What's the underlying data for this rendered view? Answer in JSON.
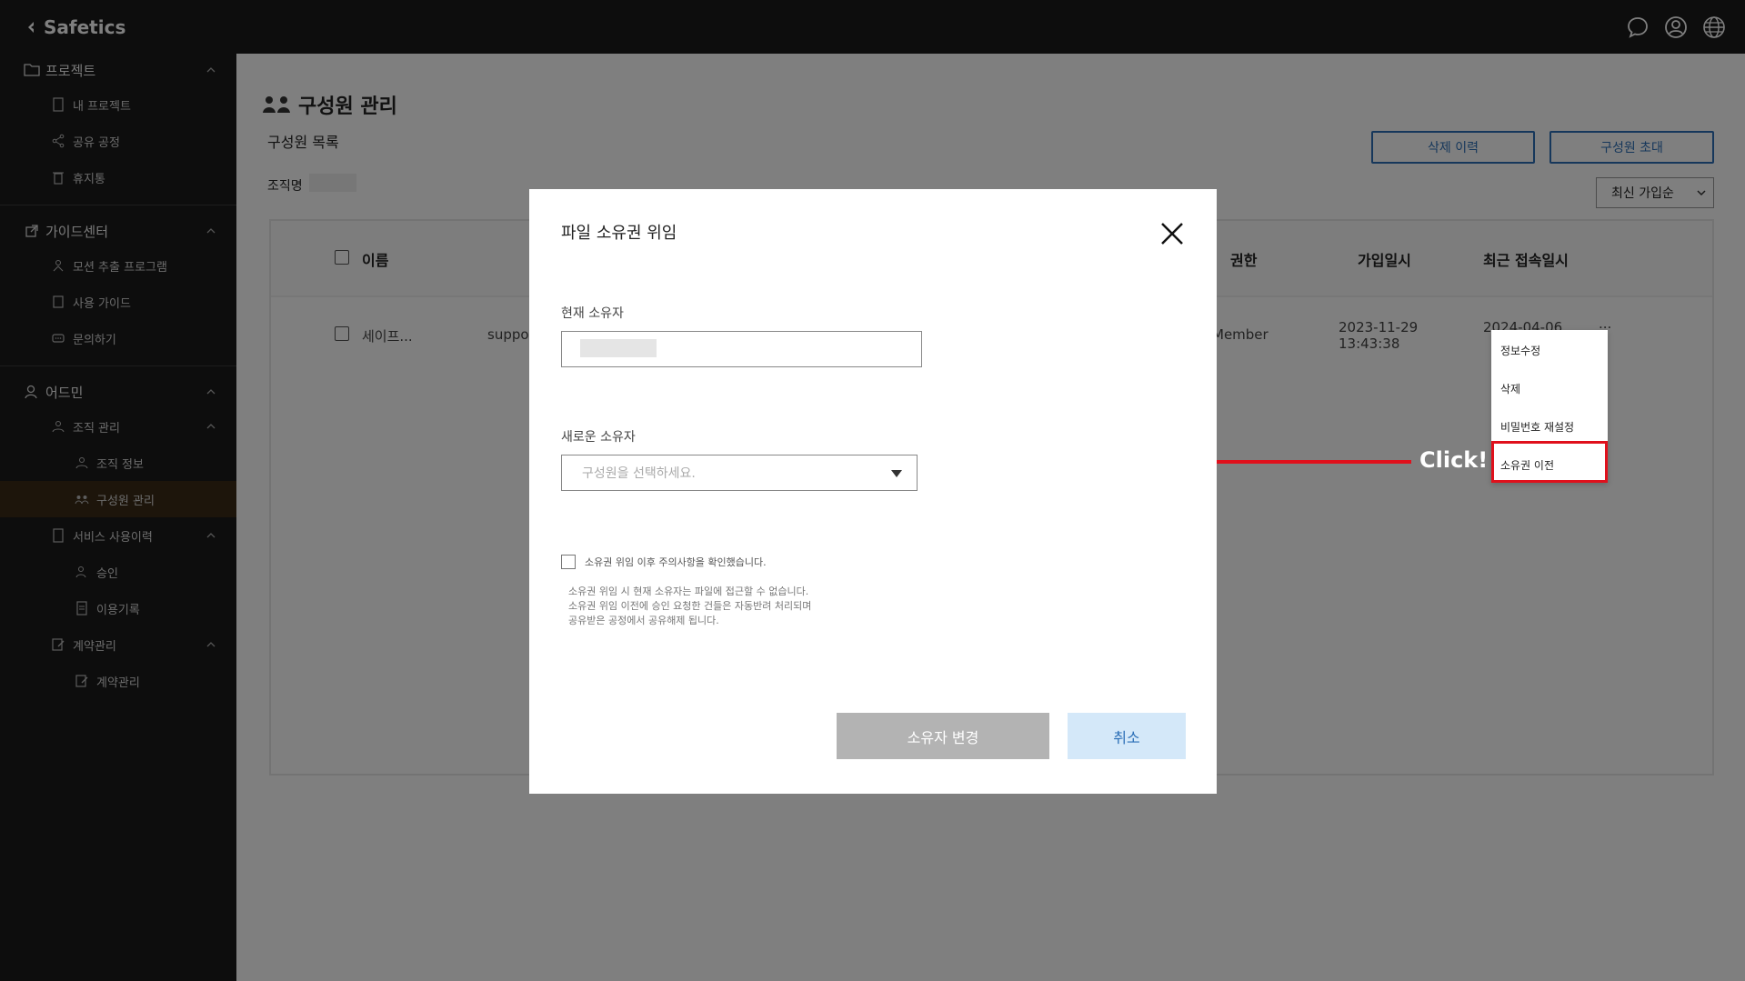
{
  "app": {
    "logo": "Safetics"
  },
  "topbar": {
    "icons": [
      "chat-icon",
      "user-icon",
      "globe-icon"
    ]
  },
  "sidebar": {
    "project": {
      "label": "프로젝트",
      "items": [
        {
          "label": "내 프로젝트",
          "icon": "document-icon"
        },
        {
          "label": "공유 공정",
          "icon": "share-icon"
        },
        {
          "label": "휴지통",
          "icon": "trash-icon"
        }
      ]
    },
    "guide": {
      "label": "가이드센터",
      "items": [
        {
          "label": "모션 추출 프로그램",
          "icon": "motion-icon"
        },
        {
          "label": "사용 가이드",
          "icon": "book-icon"
        },
        {
          "label": "문의하기",
          "icon": "message-icon"
        }
      ]
    },
    "admin": {
      "label": "어드민",
      "org": {
        "label": "조직 관리",
        "items": [
          {
            "label": "조직 정보",
            "icon": "org-icon"
          },
          {
            "label": "구성원 관리",
            "icon": "members-icon",
            "active": true
          }
        ]
      },
      "usage": {
        "label": "서비스 사용이력",
        "items": [
          {
            "label": "승인",
            "icon": "approve-icon"
          },
          {
            "label": "이용기록",
            "icon": "record-icon"
          }
        ]
      },
      "contract": {
        "label": "계약관리",
        "items": [
          {
            "label": "계약관리",
            "icon": "contract-icon"
          }
        ]
      }
    }
  },
  "main": {
    "title": "구성원 관리",
    "subtitle": "구성원 목록",
    "org_label": "조직명",
    "buttons": {
      "delete_history": "삭제 이력",
      "invite": "구성원 초대"
    },
    "sort": {
      "selected": "최신 가입순"
    },
    "table": {
      "headers": {
        "name": "이름",
        "role": "권한",
        "joined": "가입일시",
        "last_login": "최근 접속일시"
      },
      "rows": [
        {
          "name": "세이프...",
          "email": "suppo",
          "role": "Member",
          "joined_date": "2023-11-29",
          "joined_time": "13:43:38",
          "last_login": "2024-04-06",
          "more": "..."
        }
      ]
    }
  },
  "row_menu": {
    "items": [
      "정보수정",
      "삭제",
      "비밀번호 재설정",
      "소유권 이전"
    ],
    "highlighted": "소유권 이전"
  },
  "annotation": {
    "text": "Click!",
    "color": "#e0101c"
  },
  "modal": {
    "title": "파일 소유권 위임",
    "current_owner_label": "현재 소유자",
    "new_owner_label": "새로운 소유자",
    "new_owner_placeholder": "구성원을 선택하세요.",
    "agree_text": "소유권 위임 이후 주의사항을 확인했습니다.",
    "notice": [
      "소유권 위임 시 현재 소유자는 파일에 접근할 수 없습니다.",
      "소유권 위임 이전에 승인 요청한 건들은 자동반려 처리되며",
      "공유받은 공정에서 공유해제 됩니다."
    ],
    "confirm_button": "소유자 변경",
    "cancel_button": "취소"
  }
}
